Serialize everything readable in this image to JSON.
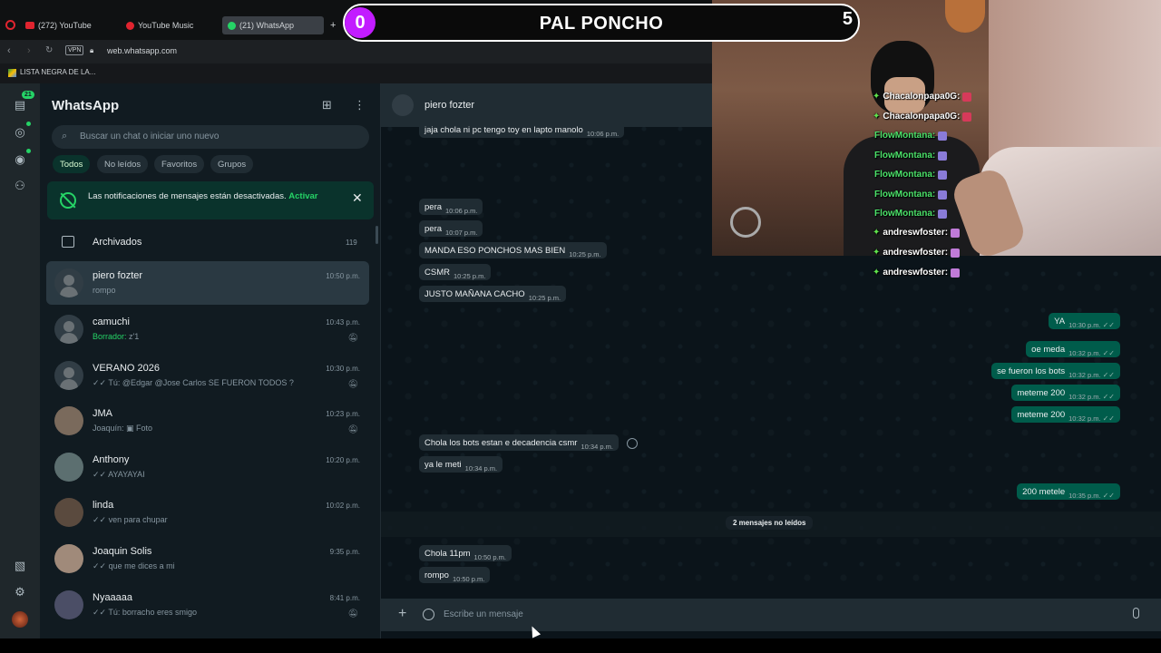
{
  "browser": {
    "tabs": [
      {
        "label": "(272) YouTube",
        "color": "#e0242f"
      },
      {
        "label": "YouTube Music",
        "color": "#e0242f"
      },
      {
        "label": "(21) WhatsApp",
        "color": "#25d366"
      }
    ],
    "vpn_label": "VPN",
    "url": "web.whatsapp.com",
    "bookmark": "LISTA NEGRA DE LA..."
  },
  "overlay": {
    "score_left": "0",
    "score_title": "PAL PONCHO",
    "score_right": "5",
    "chat_lines": [
      {
        "user": "Chacalonpapa0G:",
        "style": "white"
      },
      {
        "user": "Chacalonpapa0G:",
        "style": "white"
      },
      {
        "user": "FlowMontana:",
        "style": "green"
      },
      {
        "user": "FlowMontana:",
        "style": "green"
      },
      {
        "user": "FlowMontana:",
        "style": "green"
      },
      {
        "user": "FlowMontana:",
        "style": "green"
      },
      {
        "user": "FlowMontana:",
        "style": "green"
      },
      {
        "user": "andreswfoster:",
        "style": "white"
      },
      {
        "user": "andreswfoster:",
        "style": "white"
      },
      {
        "user": "andreswfoster:",
        "style": "white"
      }
    ]
  },
  "rail": {
    "badge": "21"
  },
  "sidebar": {
    "title": "WhatsApp",
    "search_placeholder": "Buscar un chat o iniciar uno nuevo",
    "filters": [
      "Todos",
      "No leídos",
      "Favoritos",
      "Grupos"
    ],
    "notification": {
      "text": "Las notificaciones de mensajes están desactivadas.",
      "link": "Activar"
    },
    "archived": {
      "label": "Archivados",
      "count": "119"
    },
    "chats": [
      {
        "name": "piero fozter",
        "time": "10:50 p.m.",
        "last": "rompo",
        "muted": false
      },
      {
        "name": "camuchi",
        "time": "10:43 p.m.",
        "draft": "Borrador:",
        "last": "z'1",
        "muted": true
      },
      {
        "name": "VERANO 2026",
        "time": "10:30 p.m.",
        "last": "✓✓ Tú: @Edgar @Jose Carlos SE FUERON TODOS ?",
        "muted": true
      },
      {
        "name": "JMA",
        "time": "10:23 p.m.",
        "last": "Joaquín: ▣ Foto",
        "muted": true
      },
      {
        "name": "Anthony",
        "time": "10:20 p.m.",
        "last": "✓✓ AYAYAYAI",
        "muted": false
      },
      {
        "name": "linda",
        "time": "10:02 p.m.",
        "last": "✓✓ ven para chupar",
        "muted": false
      },
      {
        "name": "Joaquin Solis",
        "time": "9:35 p.m.",
        "last": "✓✓ que me dices a mi",
        "muted": false
      },
      {
        "name": "Nyaaaaa",
        "time": "8:41 p.m.",
        "last": "✓✓ Tú: borracho eres smigo",
        "muted": true
      }
    ]
  },
  "conversation": {
    "contact": "piero fozter",
    "messages": [
      {
        "dir": "in",
        "text": "jaja chola ni pc tengo toy en lapto manolo",
        "time": "10:06 p.m."
      },
      {
        "dir": "in",
        "text": "pera",
        "time": "10:06 p.m."
      },
      {
        "dir": "in",
        "text": "pera",
        "time": "10:07 p.m."
      },
      {
        "dir": "in",
        "text": "MANDA ESO PONCHOS MAS BIEN",
        "time": "10:25 p.m."
      },
      {
        "dir": "in",
        "text": "CSMR",
        "time": "10:25 p.m."
      },
      {
        "dir": "in",
        "text": "JUSTO MAÑANA CACHO",
        "time": "10:25 p.m."
      },
      {
        "dir": "out",
        "text": "YA",
        "time": "10:30 p.m."
      },
      {
        "dir": "out",
        "text": "oe meda",
        "time": "10:32 p.m."
      },
      {
        "dir": "out",
        "text": "se fueron los bots",
        "time": "10:32 p.m."
      },
      {
        "dir": "out",
        "text": "meteme 200",
        "time": "10:32 p.m."
      },
      {
        "dir": "out",
        "text": "meteme 200",
        "time": "10:32 p.m."
      },
      {
        "dir": "in",
        "text": "Chola los  bots estan e decadencia csmr",
        "time": "10:34 p.m."
      },
      {
        "dir": "in",
        "text": "ya le meti",
        "time": "10:34 p.m."
      },
      {
        "dir": "out",
        "text": "200 metele",
        "time": "10:35 p.m."
      },
      {
        "dir": "in",
        "text": "Chola 11pm",
        "time": "10:50 p.m."
      },
      {
        "dir": "in",
        "text": "rompo",
        "time": "10:50 p.m."
      }
    ],
    "unread_banner": "2 mensajes no leídos",
    "composer_placeholder": "Escribe un mensaje"
  },
  "colors": {
    "accent": "#25d366",
    "outgoing": "#005c4b",
    "incoming": "#202c33",
    "score_badge": "#c21cff"
  }
}
